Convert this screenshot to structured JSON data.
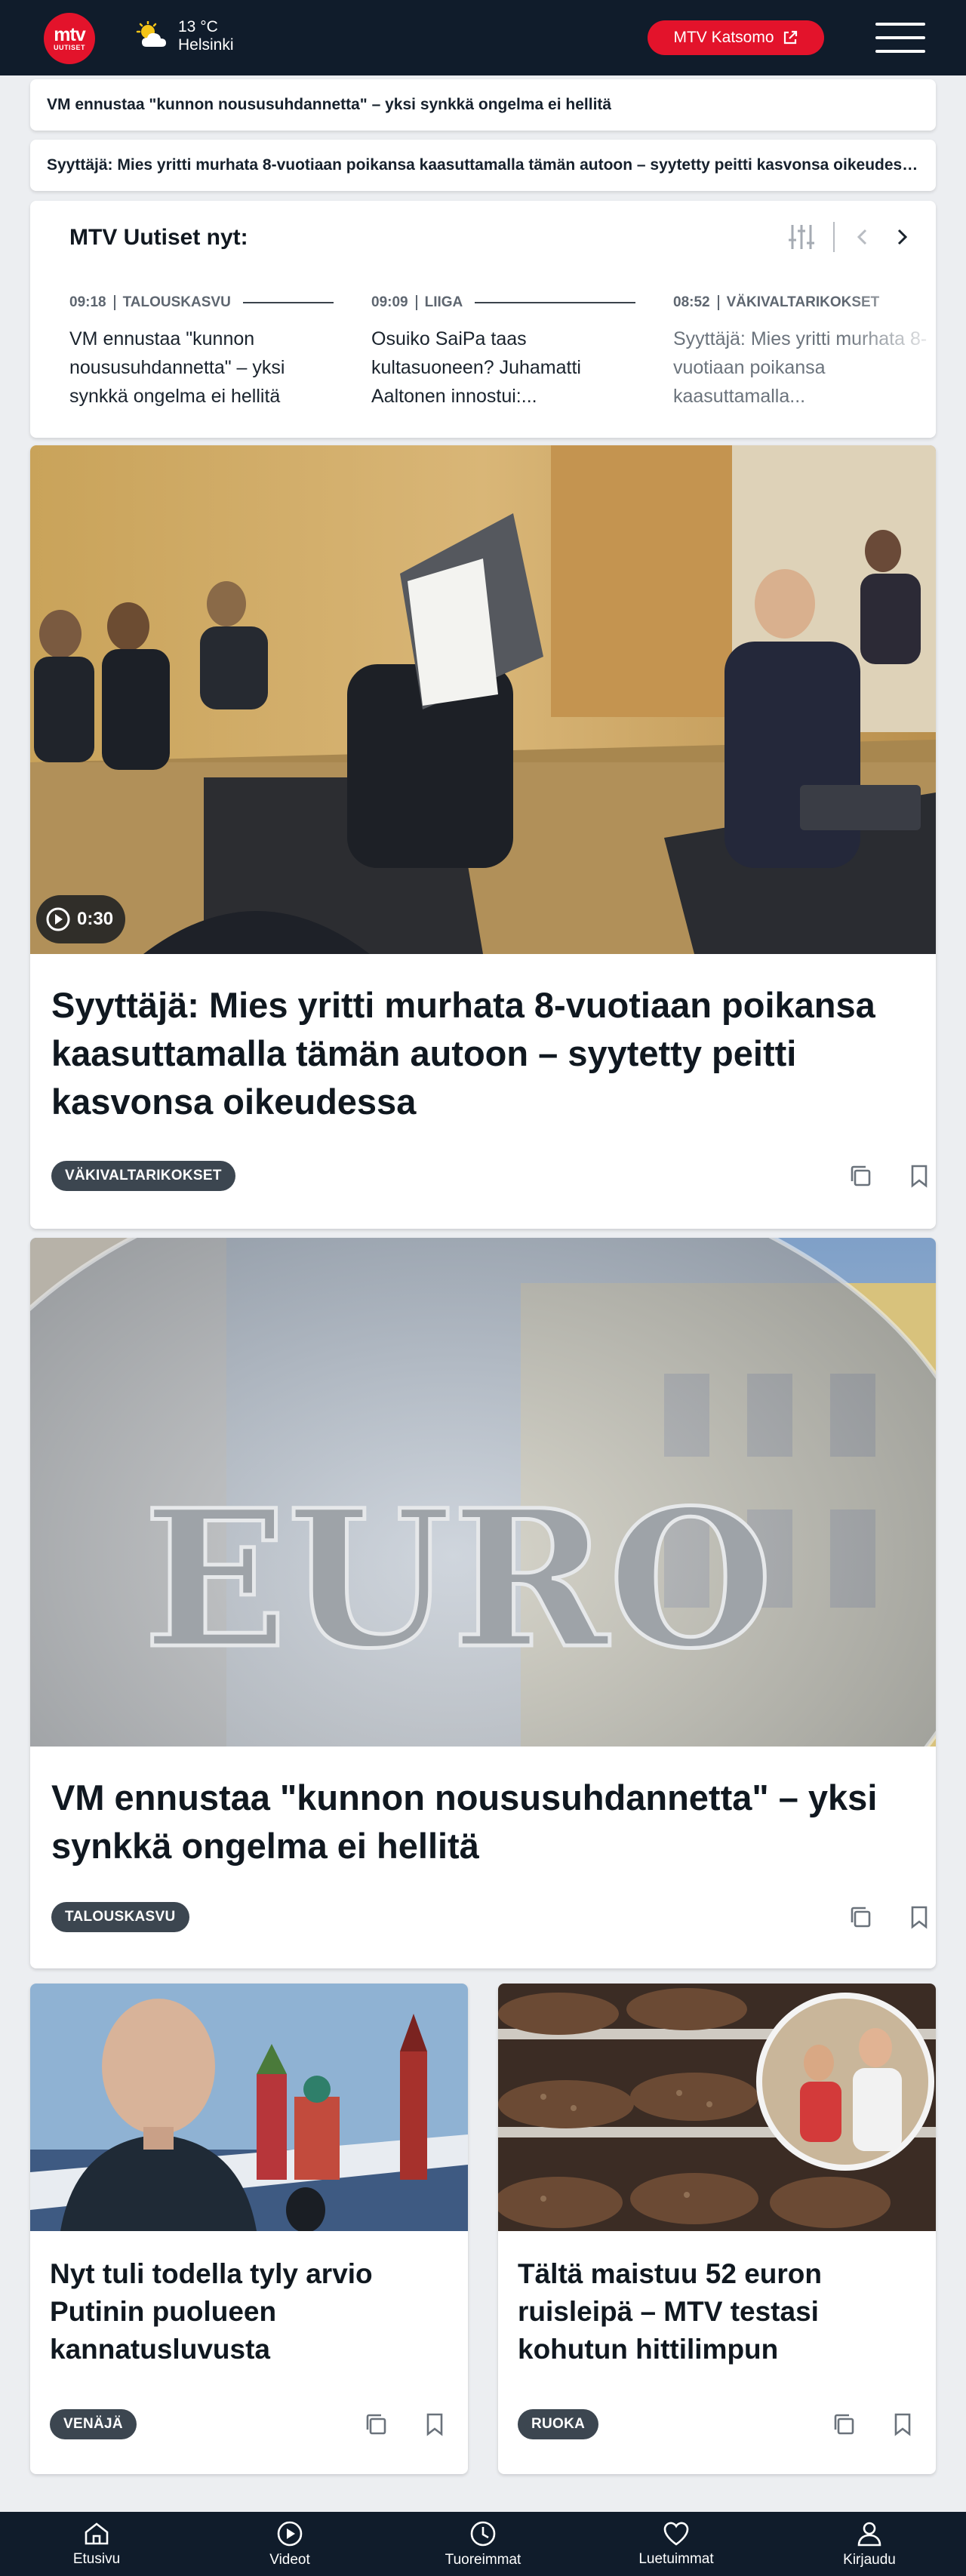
{
  "header": {
    "logo_top": "mtv",
    "logo_bottom": "UUTISET",
    "temperature": "13 °C",
    "city": "Helsinki",
    "katsomo_label": "MTV Katsomo"
  },
  "ticker": [
    "VM ennustaa \"kunnon noususuhdannetta\" – yksi synkkä ongelma ei hellitä",
    "Syyttäjä: Mies yritti murhata 8-vuotiaan poikansa kaasuttamalla tämän autoon – syytetty peitti kasvonsa oikeudessa"
  ],
  "nyt": {
    "title": "MTV Uutiset nyt:",
    "items": [
      {
        "time": "09:18",
        "category": "TALOUSKASVU",
        "headline": "VM ennustaa \"kunnon noususuhdannetta\" – yksi synkkä ongelma ei hellitä"
      },
      {
        "time": "09:09",
        "category": "LIIGA",
        "headline": "Osuiko SaiPa taas kultasuoneen? Juhamatti Aaltonen innostui:..."
      },
      {
        "time": "08:52",
        "category": "VÄKIVALTARIKOKSET",
        "headline": "Syyttäjä: Mies yritti murhata 8-vuotiaan poikansa kaasuttamalla..."
      }
    ]
  },
  "articles": {
    "a1": {
      "title": "Syyttäjä: Mies yritti murhata 8-vuotiaan poikansa kaasuttamalla tämän autoon – syytetty peitti kasvonsa oikeudessa",
      "tag": "VÄKIVALTARIKOKSET",
      "video_duration": "0:30"
    },
    "a2": {
      "title": "VM ennustaa \"kunnon noususuhdannetta\" – yksi synkkä ongelma ei hellitä",
      "tag": "TALOUSKASVU",
      "image_text": "EURO"
    },
    "a3": {
      "title": "Nyt tuli todella tyly arvio Putinin puolueen kannatusluvusta",
      "tag": "VENÄJÄ"
    },
    "a4": {
      "title": "Tältä maistuu 52 euron ruisleipä – MTV testasi kohutun hittilimpun",
      "tag": "RUOKA"
    }
  },
  "bottom_nav": [
    {
      "label": "Etusivu",
      "icon": "home-icon"
    },
    {
      "label": "Videot",
      "icon": "play-icon"
    },
    {
      "label": "Tuoreimmat",
      "icon": "clock-icon"
    },
    {
      "label": "Luetuimmat",
      "icon": "heart-icon"
    },
    {
      "label": "Kirjaudu",
      "icon": "user-icon"
    }
  ],
  "colors": {
    "brand_red": "#e3132b",
    "navy": "#101c2b",
    "tag_bg": "#3c4650"
  }
}
